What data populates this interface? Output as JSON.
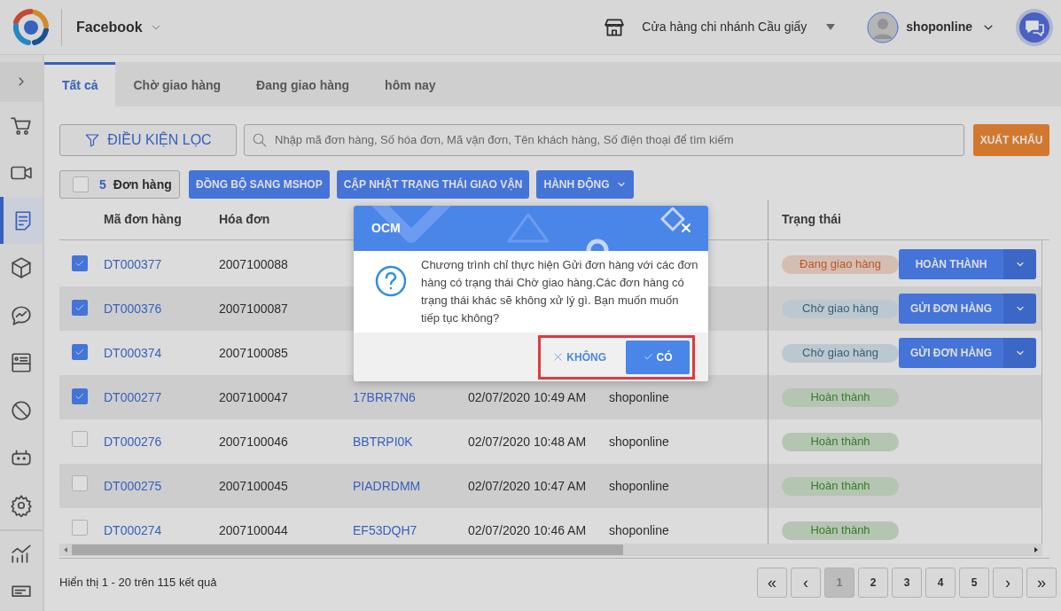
{
  "header": {
    "channel": "Facebook",
    "store": "Cửa hàng chi nhánh Cầu giấy",
    "user": "shoponline"
  },
  "sidebar": {
    "items": [
      {
        "kind": "cart",
        "selected": false
      },
      {
        "kind": "video",
        "selected": false
      },
      {
        "kind": "document",
        "selected": true
      },
      {
        "kind": "box",
        "selected": false
      },
      {
        "kind": "chat",
        "selected": false
      },
      {
        "kind": "card",
        "selected": false
      },
      {
        "kind": "ban",
        "selected": false
      },
      {
        "kind": "robot",
        "selected": false
      },
      {
        "kind": "gear",
        "selected": false
      },
      {
        "kind": "chart",
        "selected": false
      },
      {
        "kind": "list",
        "selected": false
      }
    ]
  },
  "tabs": [
    {
      "label": "Tất cả",
      "selected": true
    },
    {
      "label": "Chờ giao hàng",
      "selected": false
    },
    {
      "label": "Đang giao hàng",
      "selected": false
    },
    {
      "label": "hôm nay",
      "selected": false
    }
  ],
  "filter": {
    "label": "ĐIỀU KIỆN LỌC"
  },
  "search": {
    "placeholder": "Nhập mã đơn hàng, Số hóa đơn, Mã vận đơn, Tên khách hàng, Số điện thoại để tìm kiếm"
  },
  "export_button": "XUẤT KHẨU",
  "selection": {
    "checked": false,
    "count": "5",
    "label": "Đơn hàng"
  },
  "actions": [
    {
      "label": "ĐỒNG BỘ SANG MSHOP",
      "dropdown": false
    },
    {
      "label": "CẬP NHẬT TRẠNG THÁI GIAO VẬN",
      "dropdown": false
    },
    {
      "label": "HÀNH ĐỘNG",
      "dropdown": true
    }
  ],
  "table": {
    "columns": [
      "Mã đơn hàng",
      "Hóa đơn"
    ],
    "status_column": "Trạng thái",
    "rows": [
      {
        "checked": true,
        "code": "DT000377",
        "invoice": "2007100088",
        "status": {
          "label": "Đang giao hàng",
          "kind": "shipping"
        },
        "action": "HOÀN THÀNH"
      },
      {
        "checked": true,
        "code": "DT000376",
        "invoice": "2007100087",
        "status": {
          "label": "Chờ giao hàng",
          "kind": "waiting"
        },
        "action": "GỬI ĐƠN HÀNG"
      },
      {
        "checked": true,
        "code": "DT000374",
        "invoice": "2007100085",
        "status": {
          "label": "Chờ giao hàng",
          "kind": "waiting"
        },
        "action": "GỬI ĐƠN HÀNG"
      },
      {
        "checked": true,
        "code": "DT000277",
        "invoice": "2007100047",
        "tracking": "17BRR7N6",
        "date": "02/07/2020 10:49 AM",
        "user": "shoponline",
        "status": {
          "label": "Hoàn thành",
          "kind": "done"
        }
      },
      {
        "checked": false,
        "code": "DT000276",
        "invoice": "2007100046",
        "tracking": "BBTRPI0K",
        "date": "02/07/2020 10:48 AM",
        "user": "shoponline",
        "status": {
          "label": "Hoàn thành",
          "kind": "done"
        }
      },
      {
        "checked": false,
        "code": "DT000275",
        "invoice": "2007100045",
        "tracking": "PIADRDMM",
        "date": "02/07/2020 10:47 AM",
        "user": "shoponline",
        "status": {
          "label": "Hoàn thành",
          "kind": "done"
        }
      },
      {
        "checked": false,
        "code": "DT000274",
        "invoice": "2007100044",
        "tracking": "EF53DQH7",
        "date": "02/07/2020 10:46 AM",
        "user": "shoponline",
        "status": {
          "label": "Hoàn thành",
          "kind": "done"
        }
      }
    ]
  },
  "footer": {
    "summary": "Hiển thị 1 - 20 trên 115 kết quả",
    "pages": [
      {
        "label": "«",
        "kind": "first",
        "selected": false
      },
      {
        "label": "‹",
        "kind": "prev",
        "selected": false
      },
      {
        "label": "1",
        "kind": "page",
        "selected": true
      },
      {
        "label": "2",
        "kind": "page",
        "selected": false
      },
      {
        "label": "3",
        "kind": "page",
        "selected": false
      },
      {
        "label": "4",
        "kind": "page",
        "selected": false
      },
      {
        "label": "5",
        "kind": "page",
        "selected": false
      },
      {
        "label": "›",
        "kind": "next",
        "selected": false
      },
      {
        "label": "»",
        "kind": "last",
        "selected": false
      }
    ]
  },
  "dialog": {
    "title": "OCM",
    "message": "Chương trình chỉ thực hiện Gửi đơn hàng với các đơn hàng có trạng thái Chờ giao hàng.Các đơn hàng có trạng thái khác sẽ không xử lý gì. Bạn muốn muốn tiếp tục không?",
    "buttons": [
      {
        "label": "KHÔNG",
        "kind": "cancel"
      },
      {
        "label": "CÓ",
        "kind": "confirm"
      }
    ],
    "highlighted": true
  }
}
